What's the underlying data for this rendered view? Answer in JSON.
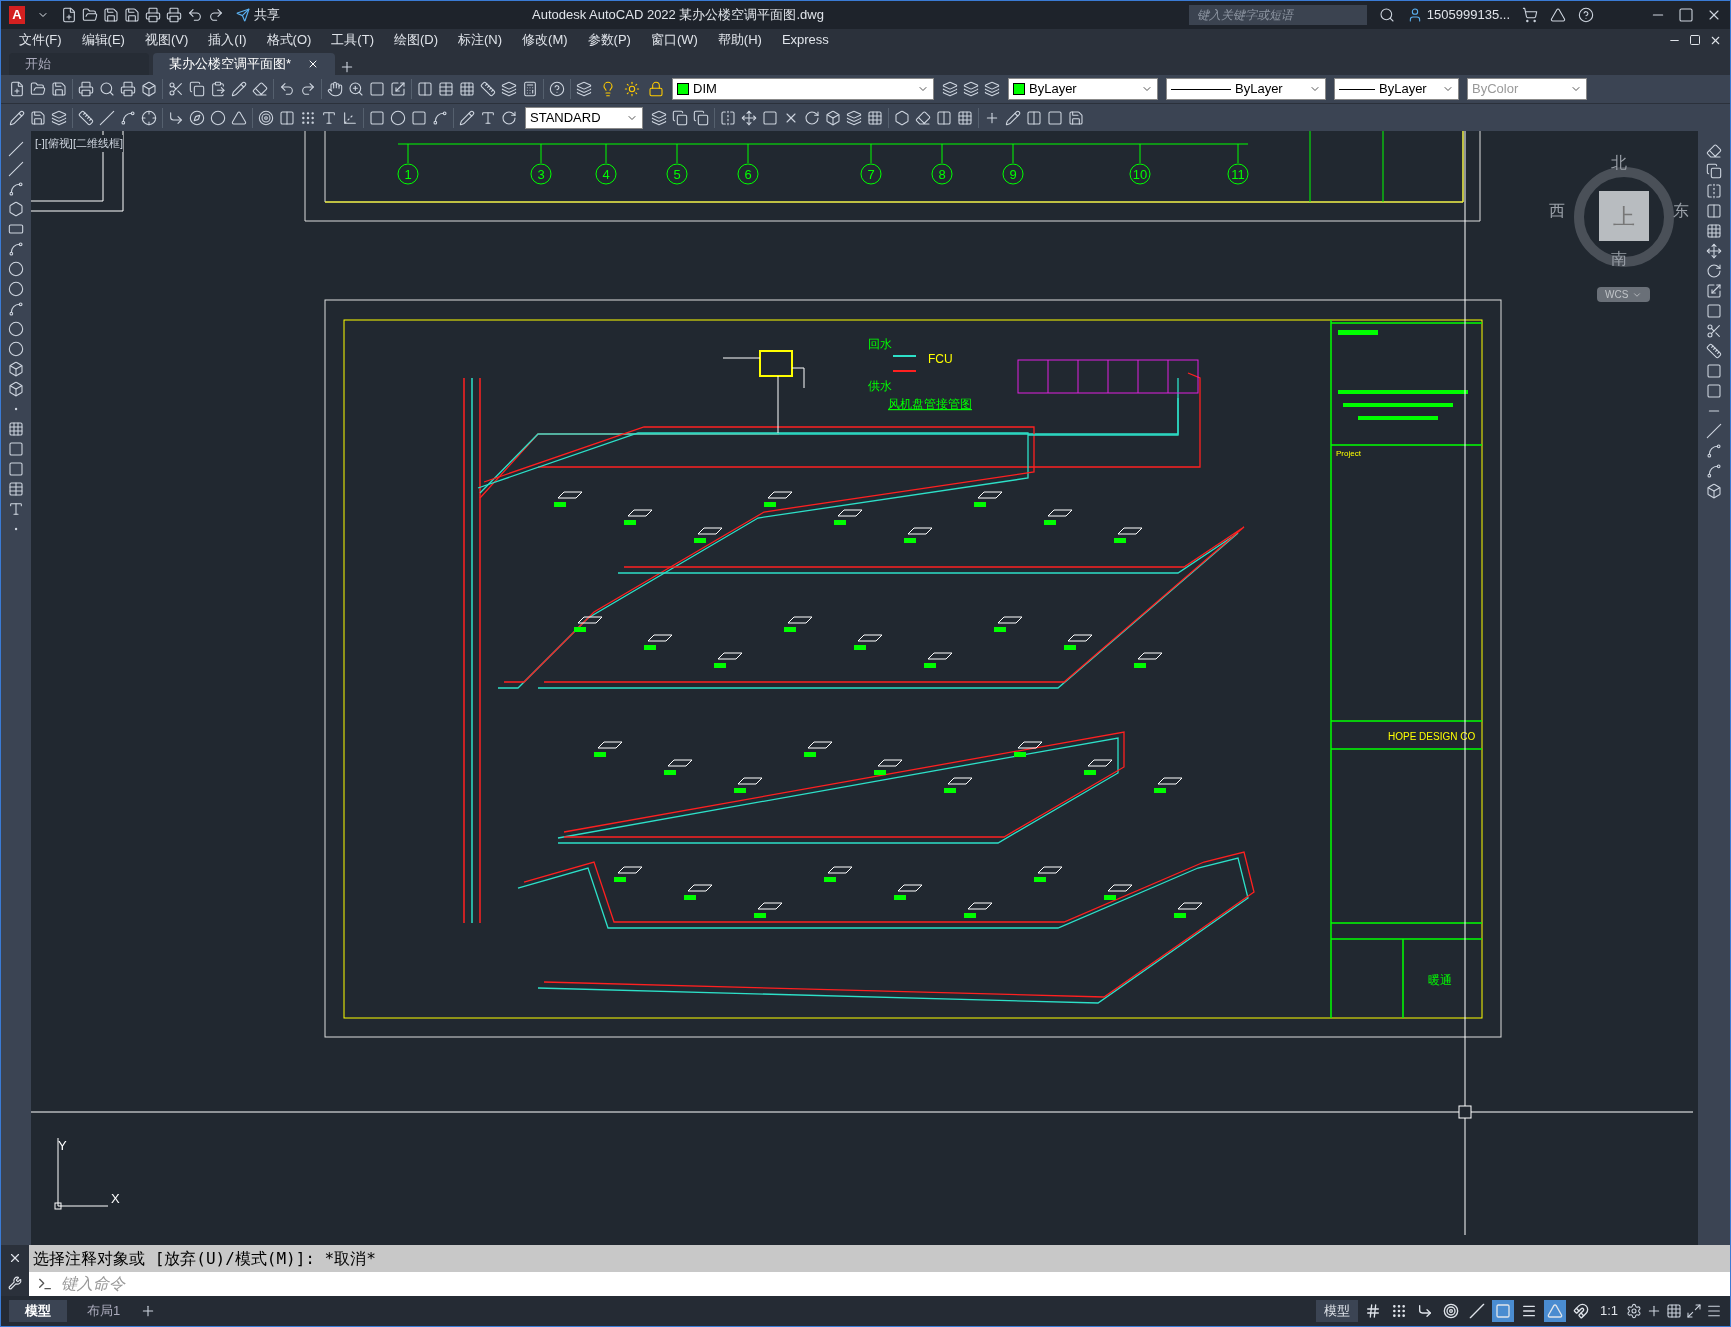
{
  "window": {
    "logo": "A",
    "title": "Autodesk AutoCAD 2022    某办公楼空调平面图.dwg",
    "share": "共享",
    "search_placeholder": "键入关键字或短语",
    "user": "1505999135..."
  },
  "menu": [
    "文件(F)",
    "编辑(E)",
    "视图(V)",
    "插入(I)",
    "格式(O)",
    "工具(T)",
    "绘图(D)",
    "标注(N)",
    "修改(M)",
    "参数(P)",
    "窗口(W)",
    "帮助(H)",
    "Express"
  ],
  "doc_tabs": [
    {
      "label": "开始",
      "selected": false
    },
    {
      "label": "某办公楼空调平面图*",
      "selected": true
    }
  ],
  "toolbar": {
    "layer": "DIM",
    "text_style": "STANDARD",
    "object_color": "ByLayer",
    "linetype": "ByLayer",
    "lineweight": "ByLayer",
    "plot_style": "ByColor"
  },
  "viewport": {
    "label": "[-][俯视][二维线框]"
  },
  "viewcube": {
    "north": "北",
    "south": "南",
    "east": "东",
    "west": "西",
    "top": "上",
    "ucs": "WCS"
  },
  "drawing": {
    "axis_labels": [
      "1",
      "3",
      "4",
      "5",
      "6",
      "7",
      "8",
      "9",
      "10",
      "11"
    ],
    "fcu": "FCU",
    "return_water": "回水",
    "supply_water": "供水",
    "detail_title": "风机盘管接管图",
    "project": "Project",
    "company": "HOPE DESIGN CO",
    "discipline": "暖通",
    "ucs_y": "Y",
    "ucs_x": "X"
  },
  "command": {
    "history": "选择注释对象或 [放弃(U)/模式(M)]: *取消*",
    "placeholder": "键入命令"
  },
  "layout_tabs": [
    {
      "label": "模型",
      "selected": true
    },
    {
      "label": "布局1",
      "selected": false
    }
  ],
  "status_bar": {
    "space": "模型",
    "scale": "1:1",
    "toggles": [
      {
        "kind": "grid",
        "on": false
      },
      {
        "kind": "snap",
        "on": false
      },
      {
        "kind": "ortho",
        "on": false
      },
      {
        "kind": "polar",
        "on": false
      },
      {
        "kind": "isodraft",
        "on": false
      },
      {
        "kind": "osnap",
        "on": true
      },
      {
        "kind": "lineweight",
        "on": false
      },
      {
        "kind": "annotation",
        "on": true
      },
      {
        "kind": "autoscale",
        "on": false
      }
    ]
  }
}
